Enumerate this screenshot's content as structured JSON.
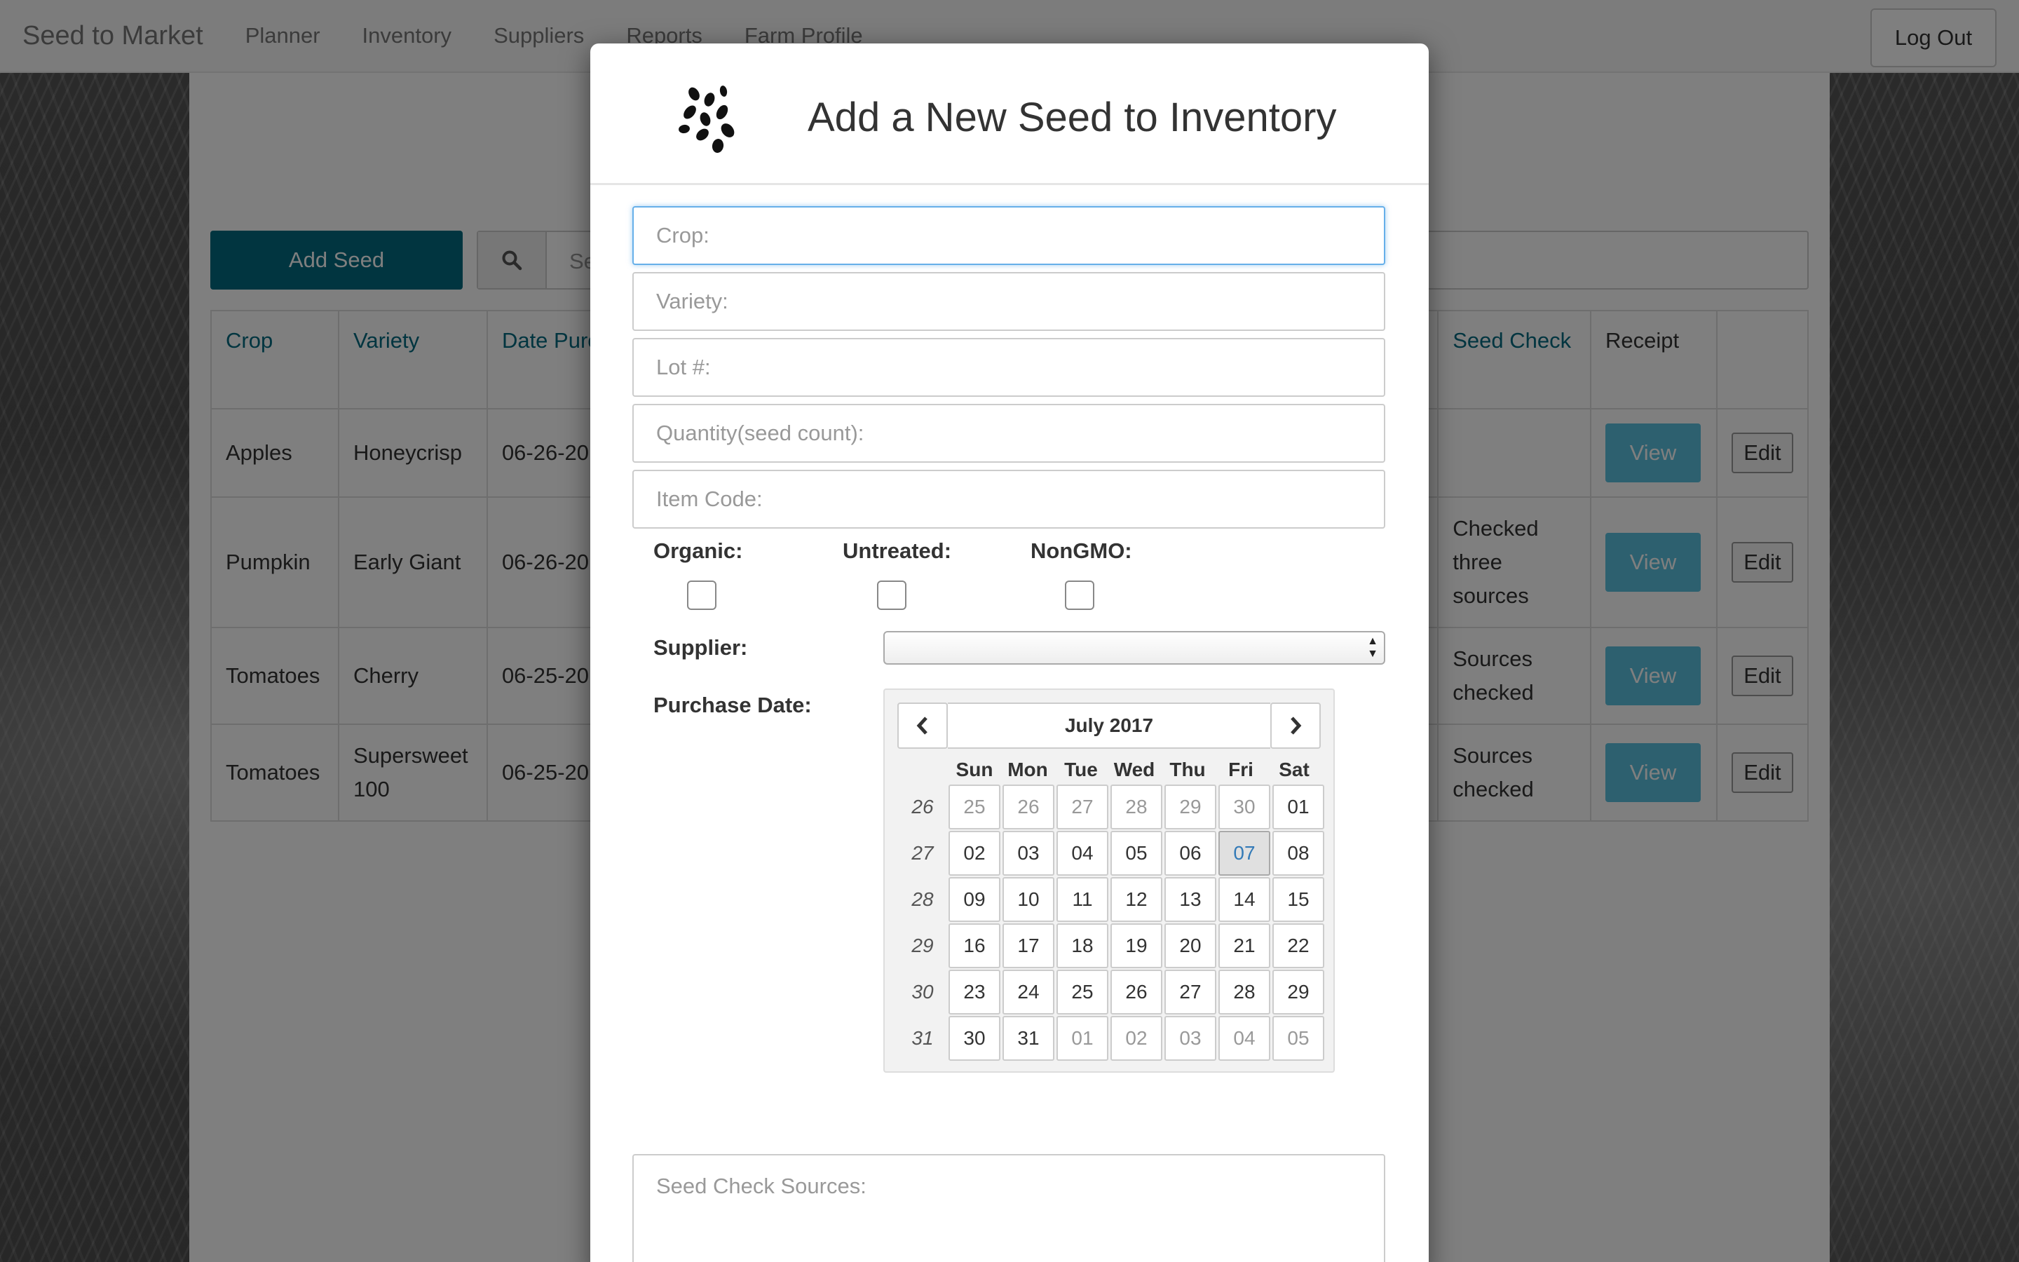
{
  "navbar": {
    "brand": "Seed to Market",
    "items": [
      "Planner",
      "Inventory",
      "Suppliers",
      "Reports",
      "Farm Profile"
    ],
    "logout": "Log Out"
  },
  "page": {
    "add_seed": "Add Seed",
    "search_placeholder": "Se",
    "table": {
      "headers": [
        "Crop",
        "Variety",
        "Date Purchase",
        "Seed Check",
        "Receipt"
      ],
      "rows": [
        {
          "crop": "Apples",
          "variety": "Honeycrisp",
          "date": "06-26-20",
          "check": "",
          "view": "View",
          "edit": "Edit"
        },
        {
          "crop": "Pumpkin",
          "variety": "Early Giant",
          "date": "06-26-20",
          "check": "Checked three sources",
          "view": "View",
          "edit": "Edit"
        },
        {
          "crop": "Tomatoes",
          "variety": "Cherry",
          "date": "06-25-20",
          "check": "Sources checked",
          "view": "View",
          "edit": "Edit"
        },
        {
          "crop": "Tomatoes",
          "variety": "Supersweet 100",
          "date": "06-25-20",
          "check": "Sources checked",
          "view": "View",
          "edit": "Edit"
        }
      ]
    }
  },
  "modal": {
    "title": "Add a New Seed to Inventory",
    "fields": {
      "crop": "Crop:",
      "variety": "Variety:",
      "lot": "Lot #:",
      "quantity": "Quantity(seed count):",
      "item_code": "Item Code:"
    },
    "checkboxes": {
      "organic": "Organic:",
      "untreated": "Untreated:",
      "nongmo": "NonGMO:"
    },
    "supplier_label": "Supplier:",
    "supplier_value": "",
    "purchase_date_label": "Purchase Date:",
    "seed_check_placeholder": "Seed Check Sources:"
  },
  "datepicker": {
    "month": "July 2017",
    "dow": [
      "Sun",
      "Mon",
      "Tue",
      "Wed",
      "Thu",
      "Fri",
      "Sat"
    ],
    "weeks": [
      {
        "wk": "26",
        "days": [
          "25",
          "26",
          "27",
          "28",
          "29",
          "30",
          "01"
        ],
        "muted": [
          0,
          1,
          2,
          3,
          4,
          5
        ]
      },
      {
        "wk": "27",
        "days": [
          "02",
          "03",
          "04",
          "05",
          "06",
          "07",
          "08"
        ],
        "muted": []
      },
      {
        "wk": "28",
        "days": [
          "09",
          "10",
          "11",
          "12",
          "13",
          "14",
          "15"
        ],
        "muted": []
      },
      {
        "wk": "29",
        "days": [
          "16",
          "17",
          "18",
          "19",
          "20",
          "21",
          "22"
        ],
        "muted": []
      },
      {
        "wk": "30",
        "days": [
          "23",
          "24",
          "25",
          "26",
          "27",
          "28",
          "29"
        ],
        "muted": []
      },
      {
        "wk": "31",
        "days": [
          "30",
          "31",
          "01",
          "02",
          "03",
          "04",
          "05"
        ],
        "muted": [
          2,
          3,
          4,
          5,
          6
        ]
      }
    ],
    "selected_day": "07"
  },
  "colors": {
    "brand_teal": "#036a80",
    "view_button": "#5bc0de",
    "focus_blue": "#66afe9",
    "link_color": "#036a80"
  },
  "icons": {
    "search": "search-icon",
    "logo": "seeds-logo-icon",
    "prev": "chevron-left-icon",
    "next": "chevron-right-icon"
  }
}
